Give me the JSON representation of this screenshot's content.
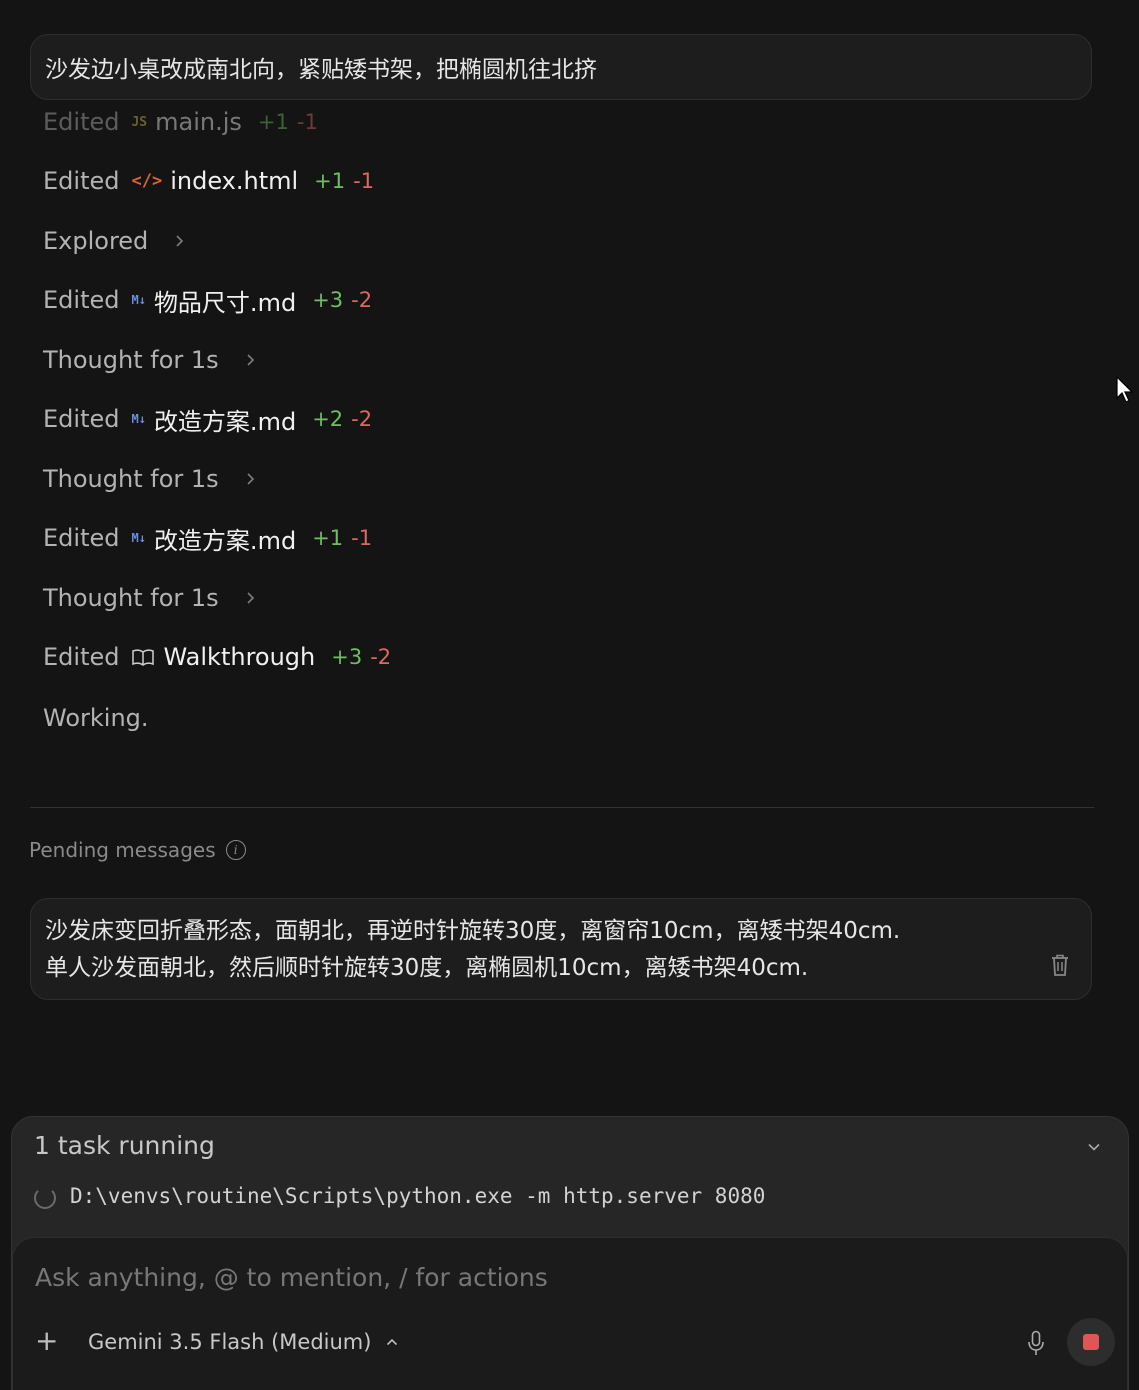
{
  "user_message": "沙发边小桌改成南北向，紧贴矮书架，把椭圆机往北挤",
  "log": [
    {
      "verb": "Edited",
      "icon": "js-file-icon",
      "icon_text": "JS",
      "file": "main.js",
      "add": "+1",
      "del": "-1",
      "faded": true
    },
    {
      "verb": "Edited",
      "icon": "html-file-icon",
      "icon_text": "</>",
      "file": "index.html",
      "add": "+1",
      "del": "-1"
    },
    {
      "verb": "Explored",
      "expandable": true
    },
    {
      "verb": "Edited",
      "icon": "markdown-file-icon",
      "icon_text": "M↓",
      "file": "物品尺寸.md",
      "add": "+3",
      "del": "-2"
    },
    {
      "verb": "Thought for 1s",
      "expandable": true
    },
    {
      "verb": "Edited",
      "icon": "markdown-file-icon",
      "icon_text": "M↓",
      "file": "改造方案.md",
      "add": "+2",
      "del": "-2"
    },
    {
      "verb": "Thought for 1s",
      "expandable": true
    },
    {
      "verb": "Edited",
      "icon": "markdown-file-icon",
      "icon_text": "M↓",
      "file": "改造方案.md",
      "add": "+1",
      "del": "-1"
    },
    {
      "verb": "Thought for 1s",
      "expandable": true
    },
    {
      "verb": "Edited",
      "icon": "book-icon",
      "icon_text": "",
      "file": "Walkthrough",
      "add": "+3",
      "del": "-2"
    },
    {
      "verb": "Working."
    }
  ],
  "pending": {
    "label": "Pending messages",
    "lines": [
      "沙发床变回折叠形态，面朝北，再逆时针旋转30度，离窗帘10cm，离矮书架40cm.",
      "单人沙发面朝北，然后顺时针旋转30度，离椭圆机10cm，离矮书架40cm."
    ]
  },
  "tasks": {
    "title": "1 task running",
    "command": "D:\\venvs\\routine\\Scripts\\python.exe -m http.server 8080"
  },
  "composer": {
    "placeholder": "Ask anything, @ to mention, / for actions",
    "value": "",
    "plus_label": "+",
    "model_label": "Gemini 3.5 Flash (Medium)"
  },
  "colors": {
    "background": "#141414",
    "added": "#6fbf62",
    "removed": "#e0675e",
    "stop": "#e05555"
  }
}
